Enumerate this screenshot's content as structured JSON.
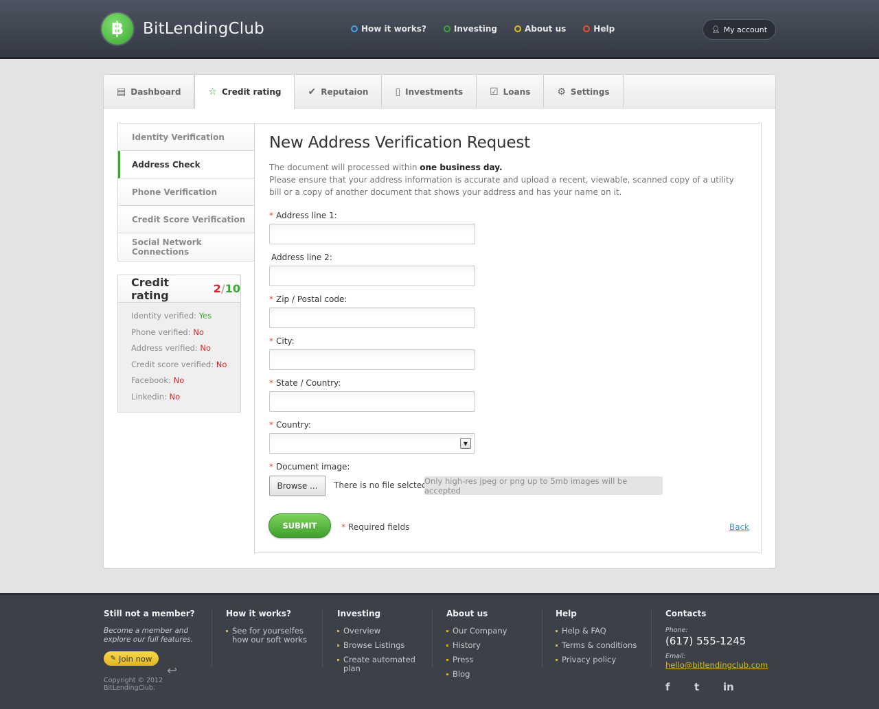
{
  "brand": {
    "name": "BitLendingClub",
    "logo_glyph": "฿"
  },
  "topnav": [
    {
      "label": "How it works?",
      "color": "#3ea5e8"
    },
    {
      "label": "Investing",
      "color": "#3aa533"
    },
    {
      "label": "About us",
      "color": "#e2c01f"
    },
    {
      "label": "Help",
      "color": "#e2552a"
    }
  ],
  "account": {
    "label": "My account",
    "icon": "user-icon"
  },
  "tabs": [
    {
      "label": "Dashboard",
      "icon": "dashboard-icon",
      "glyph": "▤"
    },
    {
      "label": "Credit rating",
      "icon": "star-icon",
      "glyph": "☆"
    },
    {
      "label": "Reputaion",
      "icon": "check-icon",
      "glyph": "✔"
    },
    {
      "label": "Investments",
      "icon": "document-icon",
      "glyph": "▯"
    },
    {
      "label": "Loans",
      "icon": "checklist-icon",
      "glyph": "☑"
    },
    {
      "label": "Settings",
      "icon": "gear-icon",
      "glyph": "⚙"
    }
  ],
  "sidemenu": [
    "Identity Verification",
    "Address Check",
    "Phone Verification",
    "Credit Score Verification",
    "Social Network Connections"
  ],
  "rating": {
    "title": "Credit rating",
    "score": "2",
    "separator": "/",
    "max": "10",
    "rows": [
      {
        "label": "Identity verified:",
        "value": "Yes"
      },
      {
        "label": "Phone verified:",
        "value": "No"
      },
      {
        "label": "Address verified:",
        "value": "No"
      },
      {
        "label": "Credit score verified:",
        "value": "No"
      },
      {
        "label": "Facebook:",
        "value": "No"
      },
      {
        "label": "Linkedin:",
        "value": "No"
      }
    ]
  },
  "form": {
    "title": "New Address Verification Request",
    "desc_prefix": "The document will processed within ",
    "desc_bold": "one business day.",
    "desc_rest": "Please ensure that your address information is accurate and upload a recent, viewable, scanned copy of a utility bill or a copy of another document that shows your address and has your name on it.",
    "required_mark": "*",
    "fields": [
      {
        "label": "Address line 1:",
        "value": ""
      },
      {
        "label": "Address line 2:",
        "value": ""
      },
      {
        "label": "Zip / Postal code:",
        "value": ""
      },
      {
        "label": "City:",
        "value": ""
      },
      {
        "label": "State / Country:",
        "value": ""
      },
      {
        "label": "Country:",
        "value": ""
      }
    ],
    "document_label": "Document image:",
    "browse": "Browse ...",
    "no_file": "There is no file selcted",
    "hint": "Only high-res jpeg or png up to 5mb images will be accepted",
    "submit": "SUBMIT",
    "required_note": "Required fields",
    "back": "Back"
  },
  "footer": {
    "member_title": "Still not a member?",
    "member_sub": "Become a member and explore our full features.",
    "join": "Join now",
    "copyright_1": "Copyright © 2012",
    "copyright_2": "BitLendingClub.",
    "how": {
      "title": "How it works?",
      "items": [
        "See for yourselfes how our soft works"
      ]
    },
    "investing": {
      "title": "Investing",
      "items": [
        "Overview",
        "Browse Listings",
        "Create automated plan"
      ]
    },
    "about": {
      "title": "About us",
      "items": [
        "Our Company",
        "History",
        "Press",
        "Blog"
      ]
    },
    "help": {
      "title": "Help",
      "items": [
        "Help & FAQ",
        "Terms & conditions",
        "Privacy policy"
      ]
    },
    "contacts": {
      "title": "Contacts",
      "phone_label": "Phone:",
      "phone": "(617) 555-1245",
      "email_label": "Email:",
      "email": "hello@bitlendingclub.com",
      "social": [
        {
          "icon": "facebook-icon",
          "glyph": "f"
        },
        {
          "icon": "twitter-icon",
          "glyph": "t"
        },
        {
          "icon": "linkedin-icon",
          "glyph": "in"
        }
      ]
    }
  }
}
